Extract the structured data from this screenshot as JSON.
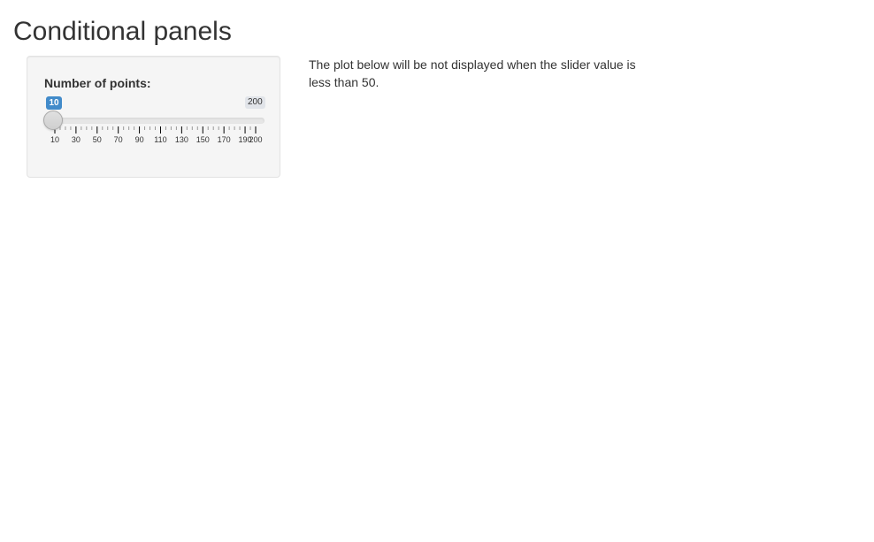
{
  "page": {
    "title": "Conditional panels"
  },
  "sidebar": {
    "slider": {
      "label": "Number of points:",
      "value": "10",
      "min": 10,
      "max": 200,
      "max_label": "200",
      "value_number": 10,
      "major_ticks": [
        "10",
        "30",
        "50",
        "70",
        "90",
        "110",
        "130",
        "150",
        "170",
        "190",
        "200"
      ],
      "accent_color": "#428bca"
    }
  },
  "main": {
    "help_text": "The plot below will be not displayed when the slider value is less than 50."
  }
}
